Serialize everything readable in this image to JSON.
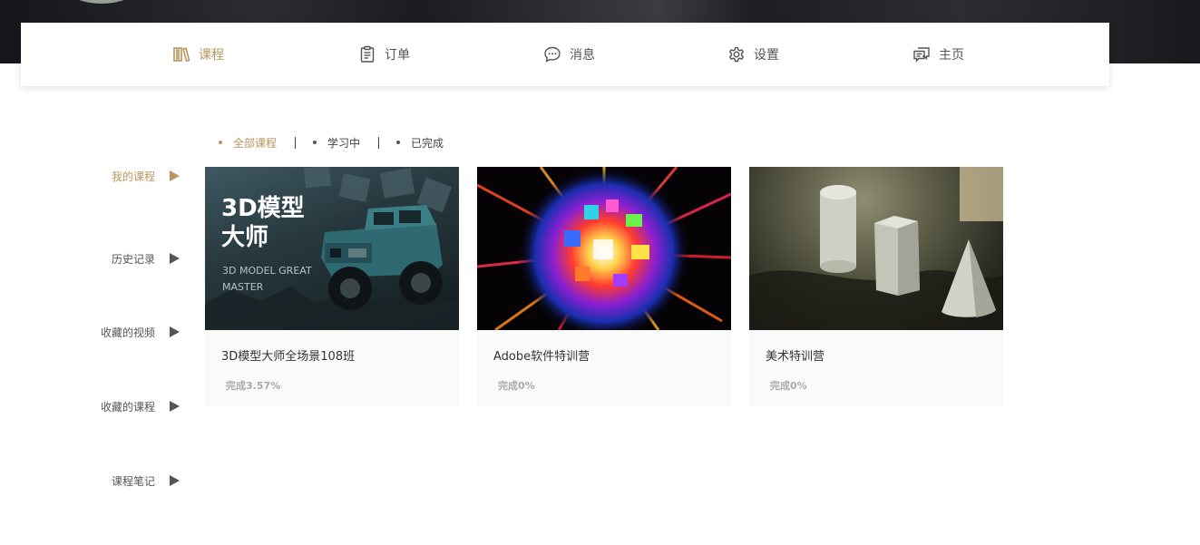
{
  "nav": {
    "items": [
      {
        "label": "课程",
        "icon": "books-icon",
        "active": true
      },
      {
        "label": "订单",
        "icon": "clipboard-icon",
        "active": false
      },
      {
        "label": "消息",
        "icon": "chat-bubble-icon",
        "active": false
      },
      {
        "label": "设置",
        "icon": "gear-icon",
        "active": false
      },
      {
        "label": "主页",
        "icon": "comments-icon",
        "active": false
      }
    ]
  },
  "sidebar": {
    "items": [
      {
        "label": "我的课程",
        "active": true
      },
      {
        "label": "历史记录",
        "active": false
      },
      {
        "label": "收藏的视频",
        "active": false
      },
      {
        "label": "收藏的课程",
        "active": false
      },
      {
        "label": "课程笔记",
        "active": false
      }
    ]
  },
  "filters": [
    {
      "label": "全部课程",
      "active": true
    },
    {
      "label": "学习中",
      "active": false
    },
    {
      "label": "已完成",
      "active": false
    }
  ],
  "courses": [
    {
      "title": "3D模型大师全场景108班",
      "progress": "完成3.57%",
      "thumb_title": "3D模型\n大师",
      "thumb_title_line1": "3D模型",
      "thumb_title_line2": "大师",
      "thumb_subtitle_line1": "3D MODEL GREAT",
      "thumb_subtitle_line2": "MASTER"
    },
    {
      "title": "Adobe软件特训营",
      "progress": "完成0%"
    },
    {
      "title": "美术特训营",
      "progress": "完成0%"
    }
  ],
  "colors": {
    "accent": "#b9965b",
    "text": "#555555",
    "card_bg": "#fafafa"
  }
}
